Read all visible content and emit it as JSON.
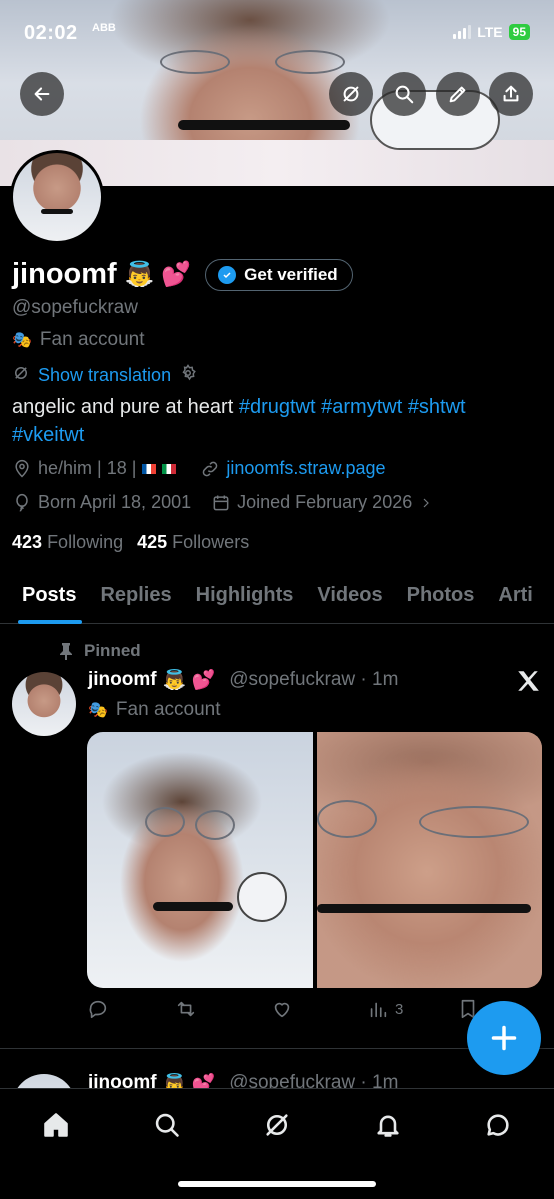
{
  "status_bar": {
    "time": "02:02",
    "time_sub": "ABB",
    "network": "LTE",
    "battery": "95"
  },
  "header_icons": {
    "back": "back-arrow-icon",
    "grok": "grok-icon",
    "search": "search-icon",
    "edit": "pencil-icon",
    "share": "share-icon"
  },
  "profile": {
    "display_name": "jinoomf",
    "name_emojis": "👼 💕",
    "verify_label": "Get verified",
    "handle": "@sopefuckraw",
    "category": "Fan account",
    "show_translation": "Show translation",
    "bio_text": "angelic and pure at heart",
    "bio_hashtags": [
      "#drugtwt",
      "#armytwt",
      "#shtwt",
      "#vkeitwt"
    ],
    "pronouns": "he/him | 18 |",
    "link": "jinoomfs.straw.page",
    "born": "Born April 18, 2001",
    "joined": "Joined February 2026",
    "following_count": "423",
    "following_label": "Following",
    "followers_count": "425",
    "followers_label": "Followers"
  },
  "tabs": [
    "Posts",
    "Replies",
    "Highlights",
    "Videos",
    "Photos",
    "Arti"
  ],
  "pinned_tweet": {
    "pinned_label": "Pinned",
    "name": "jinoomf",
    "emojis": "👼 💕",
    "handle_time": "@sopefuckraw · 1m",
    "category": "Fan account",
    "views": "3"
  },
  "second_tweet": {
    "name": "jinoomf",
    "emojis": "👼 💕",
    "handle_time": "@sopefuckraw · 1m"
  },
  "colors": {
    "accent": "#1d9bf0",
    "muted": "#71767b",
    "background": "#000000",
    "text": "#e7e9ea"
  }
}
